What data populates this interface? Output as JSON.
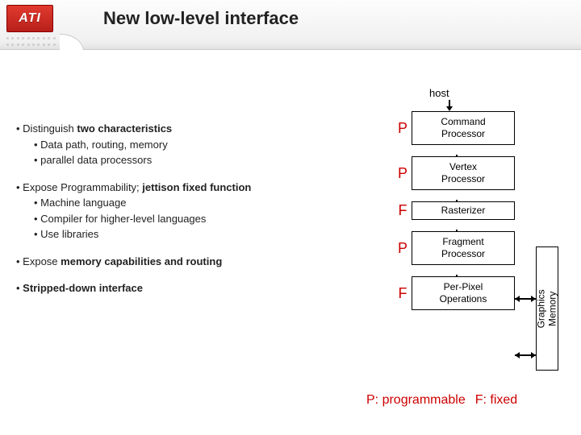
{
  "header": {
    "logo_text": "ATI",
    "title": "New low-level interface"
  },
  "bullets": [
    {
      "head_plain": "Distinguish ",
      "head_bold": "two characteristics",
      "subs": [
        "Data path, routing, memory",
        "parallel data processors"
      ]
    },
    {
      "head_plain": "Expose Programmability; ",
      "head_bold": "jettison fixed function",
      "subs": [
        "Machine language",
        "Compiler for higher-level languages",
        "Use libraries"
      ]
    },
    {
      "head_plain": "Expose ",
      "head_bold": "memory capabilities and routing",
      "subs": []
    },
    {
      "head_plain": "",
      "head_bold": "Stripped-down interface",
      "subs": []
    }
  ],
  "diagram": {
    "host_label": "host",
    "stages": [
      {
        "tag": "P",
        "label": "Command\nProcessor"
      },
      {
        "tag": "P",
        "label": "Vertex\nProcessor"
      },
      {
        "tag": "F",
        "label": "Rasterizer"
      },
      {
        "tag": "P",
        "label": "Fragment\nProcessor"
      },
      {
        "tag": "F",
        "label": "Per-Pixel\nOperations"
      }
    ],
    "memory_label": "Graphics\nMemory"
  },
  "legend": {
    "p": "P: programmable",
    "f": "F: fixed"
  }
}
